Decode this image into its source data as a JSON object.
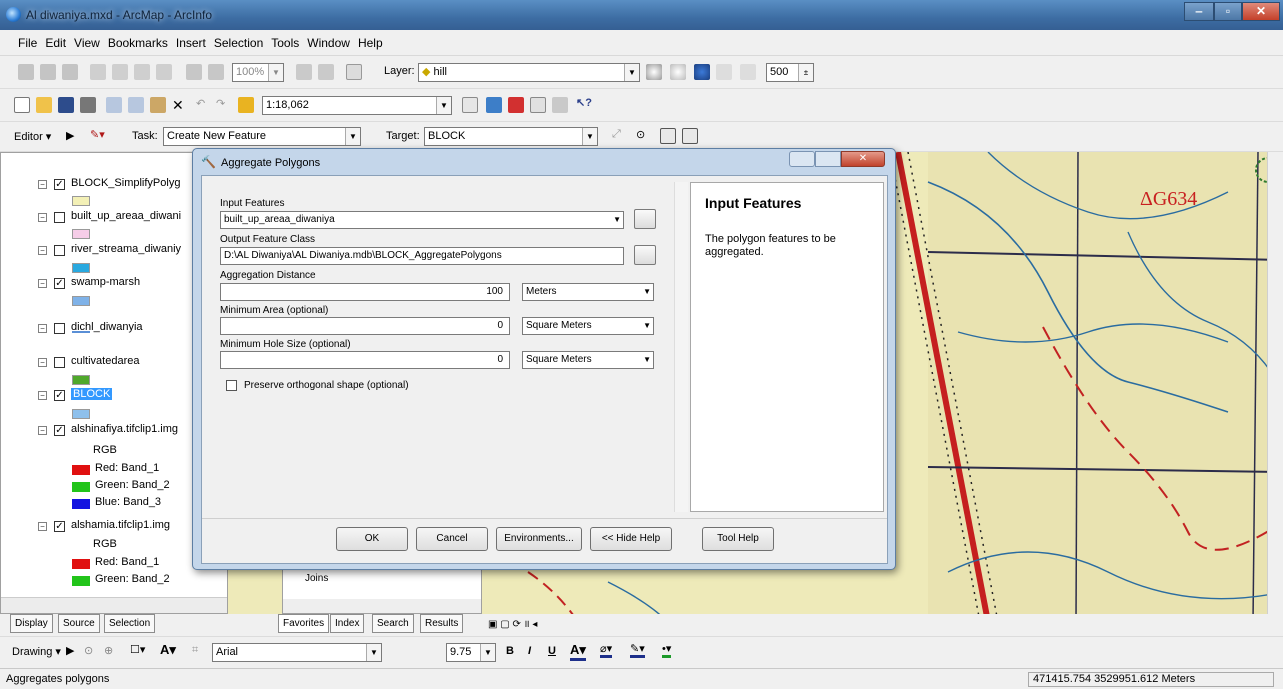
{
  "window": {
    "title": "Al diwaniya.mxd - ArcMap - ArcInfo"
  },
  "menu": [
    "File",
    "Edit",
    "View",
    "Bookmarks",
    "Insert",
    "Selection",
    "Tools",
    "Window",
    "Help"
  ],
  "toolbar1": {
    "zoom_value": "100%",
    "layer_label": "Layer:",
    "layer_value": "hill",
    "num_value": "500"
  },
  "toolbar2": {
    "scale_value": "1:18,062"
  },
  "editor": {
    "editor_label": "Editor ▾",
    "task_label": "Task:",
    "task_value": "Create New Feature",
    "target_label": "Target:",
    "target_value": "BLOCK"
  },
  "toc": {
    "layers": [
      {
        "name": "BLOCK_SimplifyPolyg",
        "checked": true,
        "swatch": "#f3f0b6"
      },
      {
        "name": "built_up_areaa_diwani",
        "checked": false,
        "swatch": "#f6cde8"
      },
      {
        "name": "river_streama_diwaniy",
        "checked": false,
        "swatch": "#29a9e0"
      },
      {
        "name": "swamp-marsh",
        "checked": true,
        "swatch": "#7fb2e8"
      },
      {
        "name": "dichl_diwanyia",
        "checked": false,
        "swatch": "#5a8fd6"
      },
      {
        "name": "cultivatedarea",
        "checked": false,
        "swatch": "#4fa82b"
      },
      {
        "name": "BLOCK",
        "checked": true,
        "swatch": "#8ec0ec"
      },
      {
        "name": "alshinafiya.tifclip1.img",
        "checked": true,
        "swatch": ""
      },
      {
        "name": "alshamia.tifclip1.img",
        "checked": true,
        "swatch": ""
      }
    ],
    "rgb_label": "RGB",
    "bands": [
      "Red:  Band_1",
      "Green: Band_2",
      "Blue:  Band_3"
    ],
    "band_colors": [
      "#e01010",
      "#22c41a",
      "#1414e0"
    ],
    "rgb2_label": "RGB",
    "bands2": [
      "Red:  Band_1",
      "Green: Band_2"
    ]
  },
  "toc_tabs": [
    "Display",
    "Source",
    "Selection"
  ],
  "catalog": {
    "item": "Joins",
    "tabs": [
      "Favorites",
      "Index",
      "Search",
      "Results"
    ]
  },
  "dialog": {
    "title": "Aggregate Polygons",
    "input_features_label": "Input Features",
    "input_features_value": "built_up_areaa_diwaniya",
    "output_label": "Output Feature Class",
    "output_value": "D:\\AL Diwaniya\\AL Diwaniya.mdb\\BLOCK_AggregatePolygons",
    "agg_dist_label": "Aggregation Distance",
    "agg_dist_value": "100",
    "agg_dist_unit": "Meters",
    "min_area_label": "Minimum Area (optional)",
    "min_area_value": "0",
    "min_area_unit": "Square Meters",
    "min_hole_label": "Minimum Hole Size (optional)",
    "min_hole_value": "0",
    "min_hole_unit": "Square Meters",
    "preserve_label": "Preserve orthogonal shape (optional)",
    "help_title": "Input Features",
    "help_text": "The polygon features to be aggregated.",
    "buttons": {
      "ok": "OK",
      "cancel": "Cancel",
      "env": "Environments...",
      "hide_help": "<< Hide Help",
      "tool_help": "Tool Help"
    }
  },
  "map": {
    "label": "ΔG634"
  },
  "drawing": {
    "label": "Drawing ▾",
    "font": "Arial",
    "size": "9.75",
    "bold": "B",
    "italic": "I",
    "underline": "U"
  },
  "status": {
    "message": "Aggregates polygons",
    "coords": "471415.754  3529951.612 Meters"
  }
}
